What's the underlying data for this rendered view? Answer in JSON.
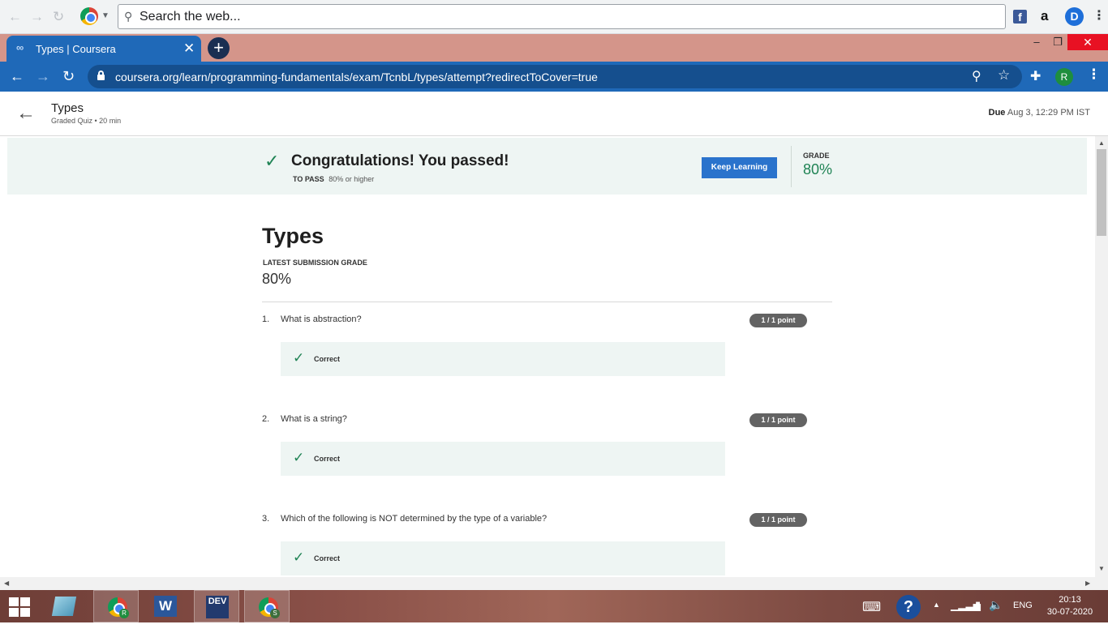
{
  "search_toolbar": {
    "placeholder": "Search the web..."
  },
  "tab": {
    "title": "Types | Coursera",
    "favicon": "coursera-infinity-icon"
  },
  "address_bar": {
    "url": "coursera.org/learn/programming-fundamentals/exam/TcnbL/types/attempt?redirectToCover=true",
    "profile_initial": "R"
  },
  "header": {
    "title": "Types",
    "subtitle": "Graded Quiz • 20 min",
    "due_label": "Due",
    "due_value": "Aug 3, 12:29 PM IST"
  },
  "banner": {
    "message": "Congratulations! You passed!",
    "to_pass_label": "TO PASS",
    "to_pass_value": "80% or higher",
    "button_label": "Keep Learning",
    "grade_label": "GRADE",
    "grade_value": "80%",
    "accent_color": "#1f8354"
  },
  "quiz": {
    "title": "Types",
    "latest_grade_label": "LATEST SUBMISSION GRADE",
    "latest_grade_value": "80%",
    "questions": [
      {
        "number": "1.",
        "text": "What is abstraction?",
        "points": "1 / 1 point",
        "feedback": "Correct"
      },
      {
        "number": "2.",
        "text": "What is a string?",
        "points": "1 / 1 point",
        "feedback": "Correct"
      },
      {
        "number": "3.",
        "text": "Which of the following is NOT determined by the type of a variable?",
        "points": "1 / 1 point",
        "feedback": "Correct"
      }
    ]
  },
  "taskbar": {
    "time": "20:13",
    "date": "30-07-2020",
    "language": "ENG",
    "word_label": "W",
    "dev_label": "DEV"
  }
}
